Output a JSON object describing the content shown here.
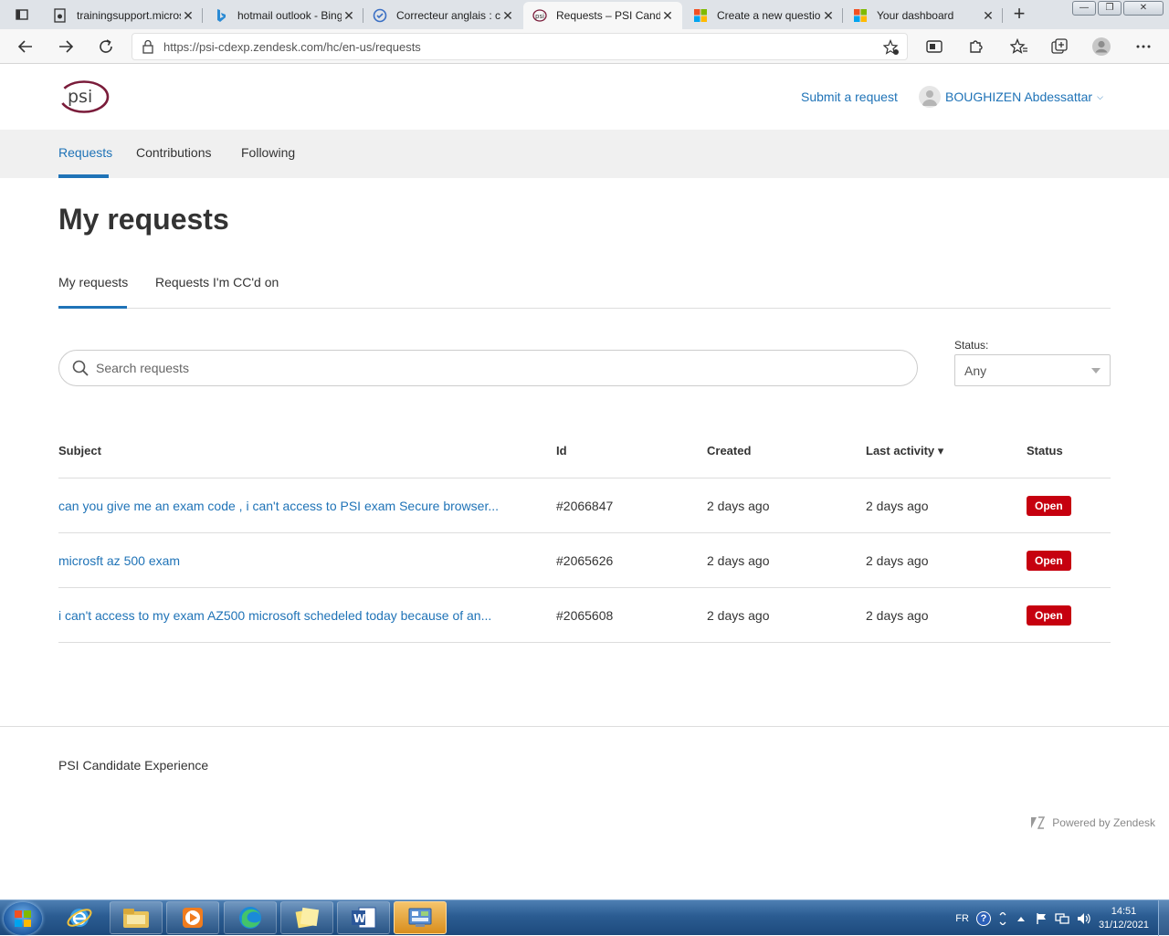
{
  "browser": {
    "tabs": [
      {
        "title": "trainingsupport.microsoft.com",
        "active": false
      },
      {
        "title": "hotmail outlook - Bing",
        "active": false
      },
      {
        "title": "Correcteur anglais : c",
        "active": false
      },
      {
        "title": "Requests – PSI Candidate Experience",
        "active": true
      },
      {
        "title": "Create a new question",
        "active": false
      },
      {
        "title": "Your dashboard",
        "active": false
      }
    ],
    "close_glyph": "✕",
    "new_tab_glyph": "+",
    "url": "https://psi-cdexp.zendesk.com/hc/en-us/requests",
    "window_buttons": {
      "minimize": "—",
      "maximize": "❐",
      "close": "✕"
    }
  },
  "header": {
    "logo_text": "psi",
    "submit_request": "Submit a request",
    "user_name": "BOUGHIZEN Abdessattar",
    "user_chevron": "⌵"
  },
  "subnav": {
    "items": [
      {
        "label": "Requests",
        "active": true
      },
      {
        "label": "Contributions",
        "active": false
      },
      {
        "label": "Following",
        "active": false
      }
    ]
  },
  "main": {
    "title": "My requests",
    "tabs": [
      {
        "label": "My requests",
        "active": true
      },
      {
        "label": "Requests I'm CC'd on",
        "active": false
      }
    ],
    "search": {
      "placeholder": "Search requests",
      "value": ""
    },
    "status_filter": {
      "label": "Status:",
      "value": "Any"
    },
    "table": {
      "columns": [
        "Subject",
        "Id",
        "Created",
        "Last activity ▾",
        "Status"
      ],
      "rows": [
        {
          "subject": "can you give me an exam code , i can't access to PSI exam Secure browser...",
          "id": "#2066847",
          "created": "2 days ago",
          "last_activity": "2 days ago",
          "status": "Open"
        },
        {
          "subject": "microsft az 500 exam",
          "id": "#2065626",
          "created": "2 days ago",
          "last_activity": "2 days ago",
          "status": "Open"
        },
        {
          "subject": "i can't access to my exam AZ500 microsoft schedeled today because of an...",
          "id": "#2065608",
          "created": "2 days ago",
          "last_activity": "2 days ago",
          "status": "Open"
        }
      ]
    }
  },
  "footer": {
    "brand": "PSI Candidate Experience",
    "powered_by": "Powered by Zendesk"
  },
  "taskbar": {
    "language": "FR",
    "help": "?",
    "time": "14:51",
    "date": "31/12/2021",
    "icons": [
      "windows-start-icon",
      "internet-explorer-icon",
      "file-explorer-icon",
      "media-player-icon",
      "edge-icon",
      "sticky-notes-icon",
      "word-icon",
      "control-panel-icon"
    ]
  },
  "colors": {
    "link": "#1f73b7",
    "badge_open": "#c6000f",
    "subnav_bg": "#f0f0f0",
    "logo": "#7a1c3a"
  }
}
